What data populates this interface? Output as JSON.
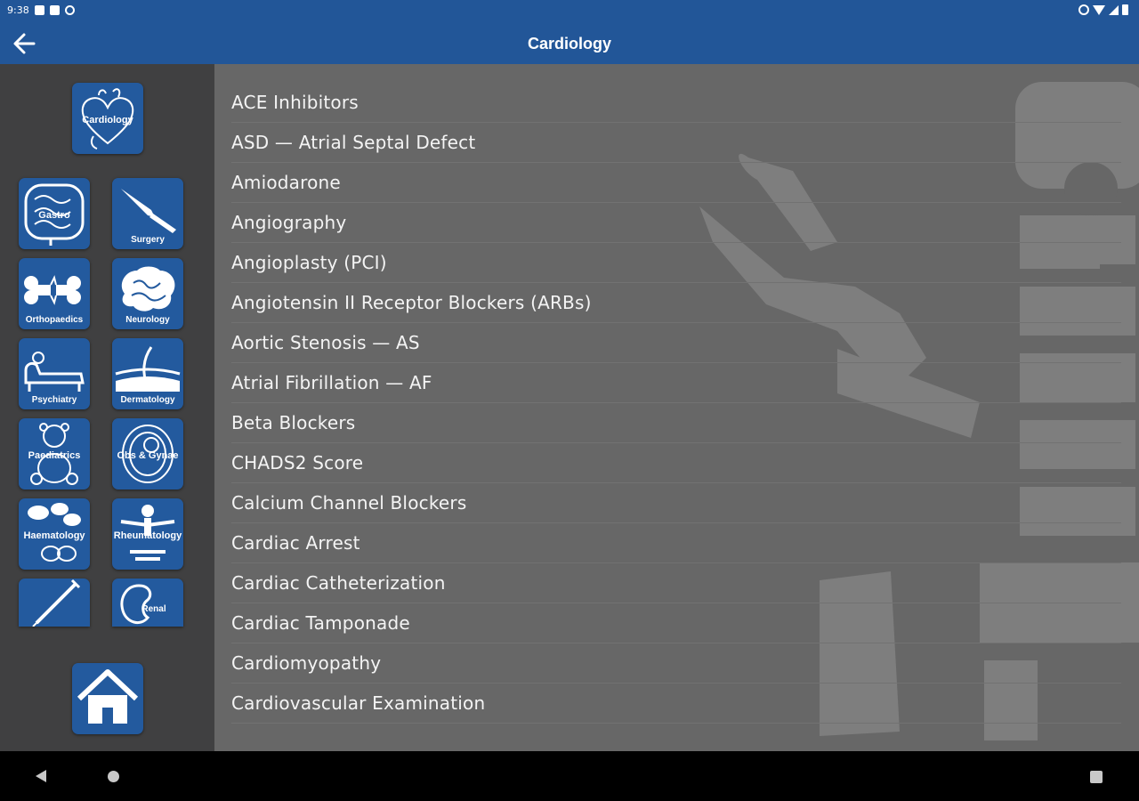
{
  "status_bar": {
    "time": "9:38"
  },
  "app_bar": {
    "title": "Cardiology"
  },
  "sidebar": {
    "current": {
      "label": "Cardiology"
    },
    "categories": [
      {
        "label": "Gastro"
      },
      {
        "label": "Surgery"
      },
      {
        "label": "Orthopaedics"
      },
      {
        "label": "Neurology"
      },
      {
        "label": "Psychiatry"
      },
      {
        "label": "Dermatology"
      },
      {
        "label": "Paediatrics"
      },
      {
        "label": "Obs & Gynae"
      },
      {
        "label": "Haematology"
      },
      {
        "label": "Rheumatology"
      },
      {
        "label": ""
      },
      {
        "label": "Renal"
      }
    ]
  },
  "topics": [
    "ACE Inhibitors",
    "ASD — Atrial Septal Defect",
    "Amiodarone",
    "Angiography",
    "Angioplasty (PCI)",
    "Angiotensin II Receptor Blockers (ARBs)",
    "Aortic Stenosis — AS",
    "Atrial Fibrillation — AF",
    "Beta Blockers",
    "CHADS2 Score",
    "Calcium Channel Blockers",
    "Cardiac Arrest",
    "Cardiac Catheterization",
    "Cardiac Tamponade",
    "Cardiomyopathy",
    "Cardiovascular Examination"
  ],
  "colors": {
    "app_bar": "#225698",
    "sidebar": "#404041",
    "list_background": "#676767",
    "tile": "#235a9e"
  }
}
